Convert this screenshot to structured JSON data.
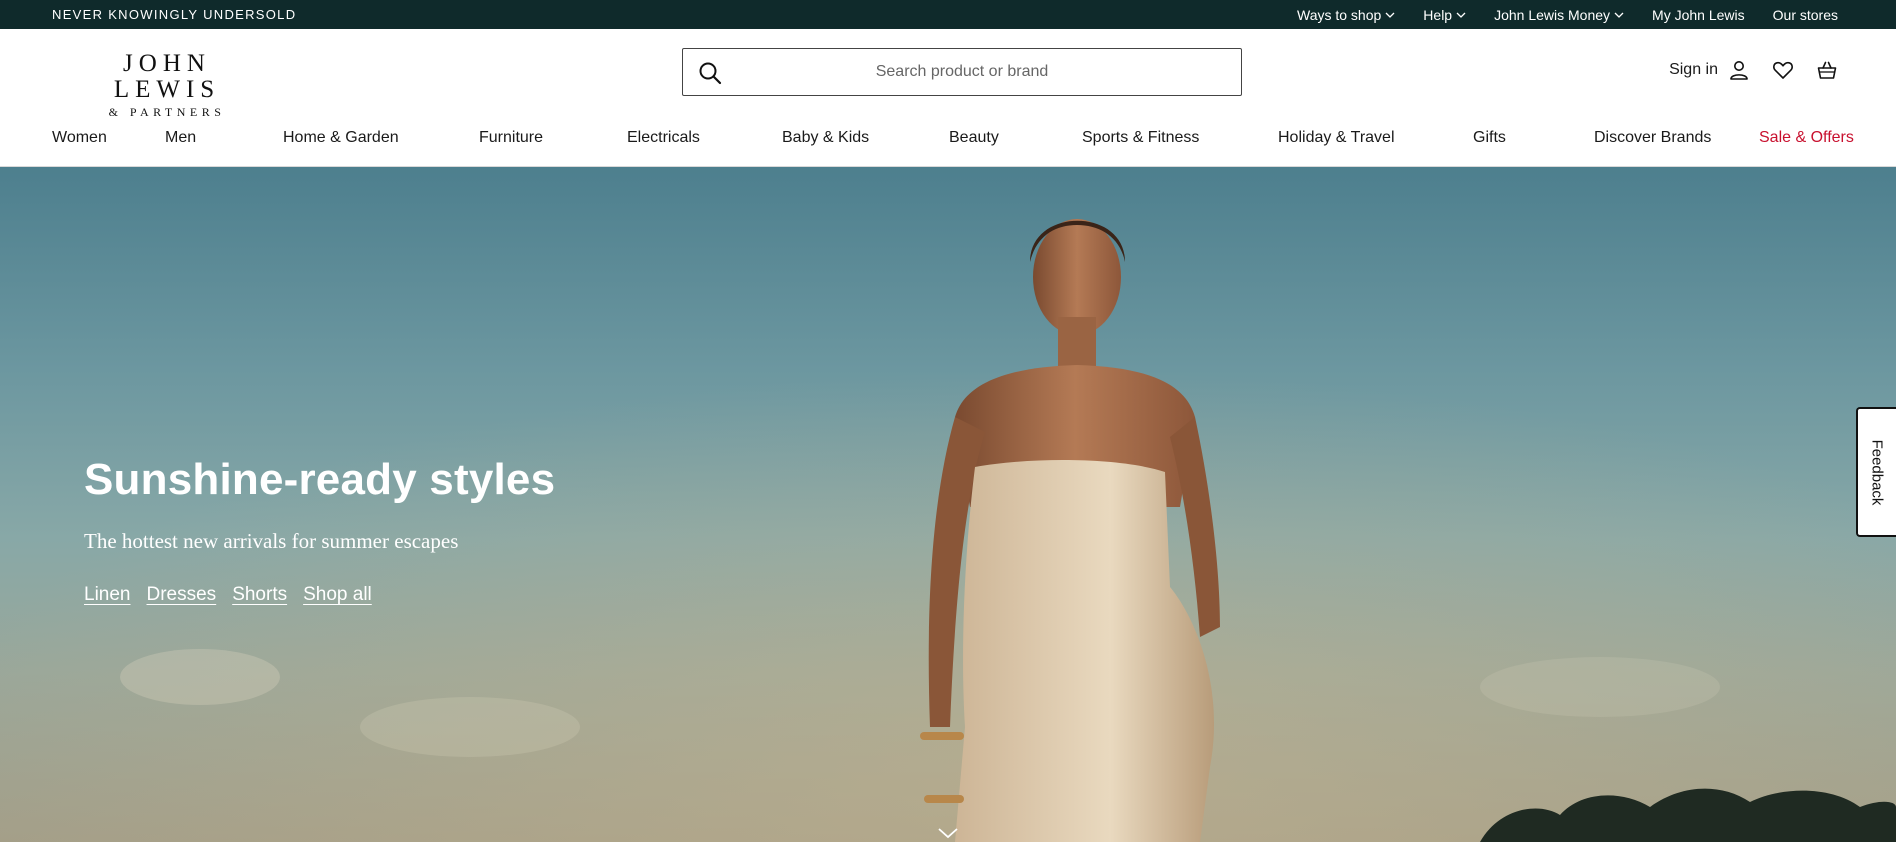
{
  "topbar": {
    "tagline": "NEVER KNOWINGLY UNDERSOLD",
    "links": [
      {
        "label": "Ways to shop",
        "dropdown": true
      },
      {
        "label": "Help",
        "dropdown": true
      },
      {
        "label": "John Lewis Money",
        "dropdown": true
      },
      {
        "label": "My John Lewis",
        "dropdown": false
      },
      {
        "label": "Our stores",
        "dropdown": false
      }
    ]
  },
  "header": {
    "logo_main": "JOHN LEWIS",
    "logo_sub": "& PARTNERS",
    "search_placeholder": "Search product or brand",
    "signin_label": "Sign in"
  },
  "nav": {
    "items": [
      {
        "label": "Women"
      },
      {
        "label": "Men"
      },
      {
        "label": "Home & Garden"
      },
      {
        "label": "Furniture"
      },
      {
        "label": "Electricals"
      },
      {
        "label": "Baby & Kids"
      },
      {
        "label": "Beauty"
      },
      {
        "label": "Sports & Fitness"
      },
      {
        "label": "Holiday & Travel"
      },
      {
        "label": "Gifts"
      },
      {
        "label": "Discover Brands"
      },
      {
        "label": "Sale & Offers"
      }
    ]
  },
  "hero": {
    "title": "Sunshine-ready styles",
    "subtitle": "The hottest new arrivals for summer escapes",
    "links": [
      {
        "label": "Linen"
      },
      {
        "label": "Dresses"
      },
      {
        "label": "Shorts"
      },
      {
        "label": "Shop all"
      }
    ]
  },
  "feedback": {
    "label": "Feedback"
  },
  "colors": {
    "topbar_bg": "#0f2a2b",
    "sale_red": "#c8102e",
    "text": "#1a1a1a"
  },
  "icons": [
    "chevron-down-icon",
    "search-icon",
    "user-icon",
    "heart-icon",
    "basket-icon",
    "scroll-down-chevron-icon"
  ]
}
